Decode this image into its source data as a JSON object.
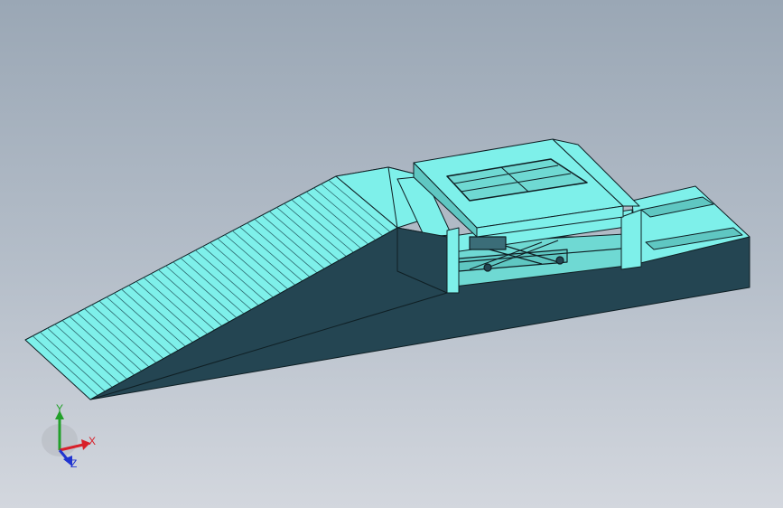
{
  "viewport": {
    "background_top": "#9aa7b5",
    "background_bottom": "#d3d7de"
  },
  "model": {
    "face_light": "#7ef0ea",
    "face_shadow": "#244552",
    "face_mid": "#3b6d78",
    "edge": "#0f1f24",
    "ramp_slats": 42
  },
  "triad": {
    "x_label": "X",
    "y_label": "Y",
    "z_label": "Z",
    "x_color": "#d8202a",
    "y_color": "#22a02a",
    "z_color": "#2034d0"
  }
}
